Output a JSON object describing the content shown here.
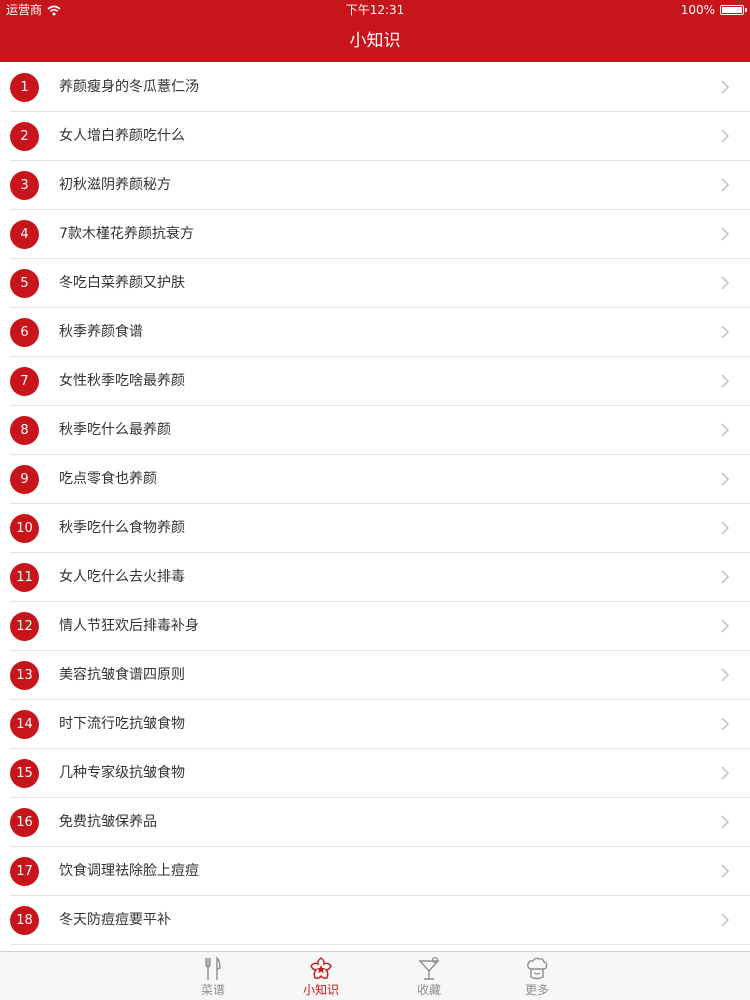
{
  "status_bar": {
    "carrier": "运营商",
    "time": "下午12:31",
    "battery": "100%",
    "battery_level": 1.0
  },
  "nav": {
    "title": "小知识"
  },
  "items": [
    {
      "num": "1",
      "title": "养颜瘦身的冬瓜薏仁汤"
    },
    {
      "num": "2",
      "title": "女人增白养颜吃什么"
    },
    {
      "num": "3",
      "title": "初秋滋阴养颜秘方"
    },
    {
      "num": "4",
      "title": "7款木槿花养颜抗衰方"
    },
    {
      "num": "5",
      "title": "冬吃白菜养颜又护肤"
    },
    {
      "num": "6",
      "title": "秋季养颜食谱"
    },
    {
      "num": "7",
      "title": "女性秋季吃啥最养颜"
    },
    {
      "num": "8",
      "title": "秋季吃什么最养颜"
    },
    {
      "num": "9",
      "title": "吃点零食也养颜"
    },
    {
      "num": "10",
      "title": "秋季吃什么食物养颜"
    },
    {
      "num": "11",
      "title": "女人吃什么去火排毒"
    },
    {
      "num": "12",
      "title": "情人节狂欢后排毒补身"
    },
    {
      "num": "13",
      "title": "美容抗皱食谱四原则"
    },
    {
      "num": "14",
      "title": "时下流行吃抗皱食物"
    },
    {
      "num": "15",
      "title": "几种专家级抗皱食物"
    },
    {
      "num": "16",
      "title": "免费抗皱保养品"
    },
    {
      "num": "17",
      "title": "饮食调理祛除脸上痘痘"
    },
    {
      "num": "18",
      "title": "冬天防痘痘要平补"
    }
  ],
  "tabs": [
    {
      "label": "菜谱",
      "icon": "fork-knife-icon",
      "active": false
    },
    {
      "label": "小知识",
      "icon": "flower-star-icon",
      "active": true
    },
    {
      "label": "收藏",
      "icon": "cocktail-glass-icon",
      "active": false
    },
    {
      "label": "更多",
      "icon": "chef-hat-icon",
      "active": false
    }
  ],
  "colors": {
    "brand_red": "#c8141b",
    "tab_inactive": "#8e8e8e",
    "separator": "#e3e3e3"
  }
}
